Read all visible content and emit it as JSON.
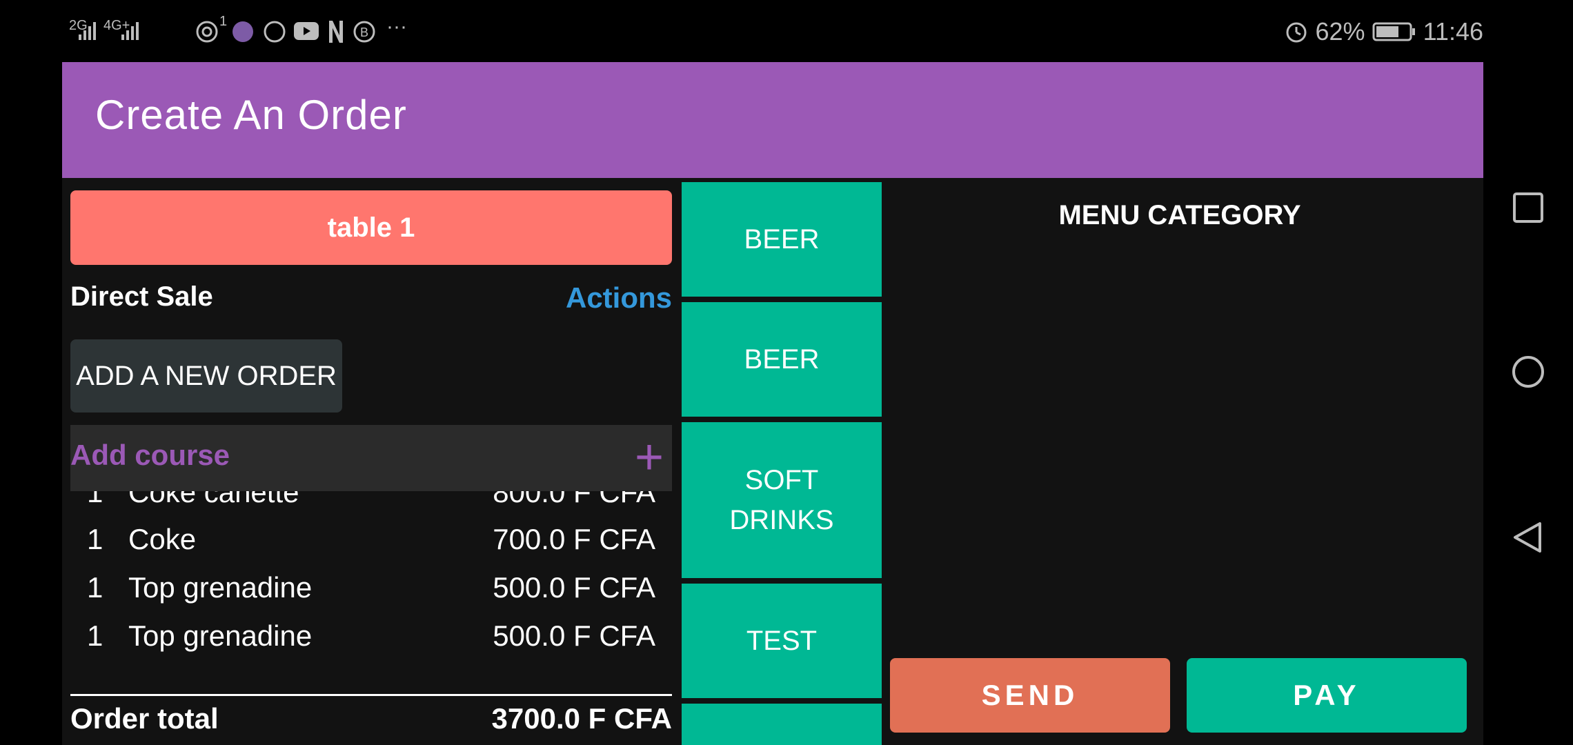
{
  "status_bar": {
    "left_indicators": [
      "2G",
      "4G+"
    ],
    "notification_count": "1",
    "battery": "62%",
    "time": "11:46"
  },
  "header": {
    "title": "Create An Order"
  },
  "order_panel": {
    "table_button": "table 1",
    "direct_sale_label": "Direct Sale",
    "actions_link": "Actions",
    "add_order_button": "ADD A NEW ORDER",
    "add_course_label": "Add course",
    "add_course_icon": "+",
    "items": [
      {
        "qty": "1",
        "name": "Coke canette",
        "price": "800.0 F CFA"
      },
      {
        "qty": "1",
        "name": "Coke",
        "price": "700.0 F CFA"
      },
      {
        "qty": "1",
        "name": "Top grenadine",
        "price": "500.0 F CFA"
      },
      {
        "qty": "1",
        "name": "Top grenadine",
        "price": "500.0 F CFA"
      }
    ],
    "total_label": "Order total",
    "total_value": "3700.0 F CFA"
  },
  "categories": [
    "BEER",
    "BEER",
    "SOFT DRINKS",
    "TEST",
    ""
  ],
  "right_panel": {
    "heading": "MENU CATEGORY",
    "send_button": "SEND",
    "pay_button": "PAY"
  },
  "colors": {
    "header": "#9b59b6",
    "table_button": "#ff766e",
    "category": "#00b894",
    "send": "#e17055",
    "pay": "#00b894",
    "actions": "#3498db"
  }
}
